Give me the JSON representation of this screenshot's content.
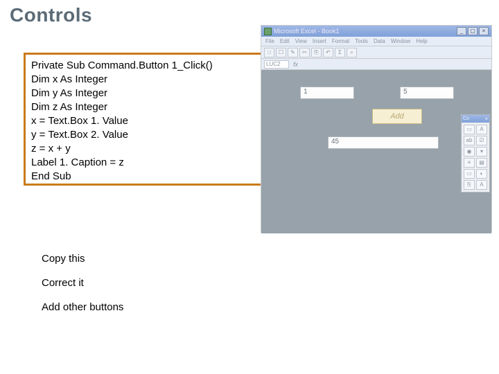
{
  "title": "Controls",
  "code": [
    "Private Sub Command.Button 1_Click()",
    "Dim x As Integer",
    "Dim y As Integer",
    "Dim z As Integer",
    "x = Text.Box 1. Value",
    "y = Text.Box 2. Value",
    "z = x + y",
    "Label 1. Caption = z",
    "End Sub"
  ],
  "instructions": [
    "Copy this",
    "Correct it",
    "Add other buttons"
  ],
  "excel": {
    "apptitle": "Microsoft Excel - Book1",
    "menus": [
      "File",
      "Edit",
      "View",
      "Insert",
      "Format",
      "Tools",
      "Data",
      "Window",
      "Help"
    ],
    "namebox": "LUC2",
    "fx": "fx",
    "textbox1_value": "1",
    "textbox2_value": "5",
    "add_button": "Add",
    "result_label": "45",
    "toolbox_title": "Co",
    "toolbox_glyphs": [
      "▭",
      "A",
      "ab",
      "☑",
      "◉",
      "▾",
      "≡",
      "▤",
      "▭",
      "◐",
      "⎘",
      "A"
    ]
  }
}
